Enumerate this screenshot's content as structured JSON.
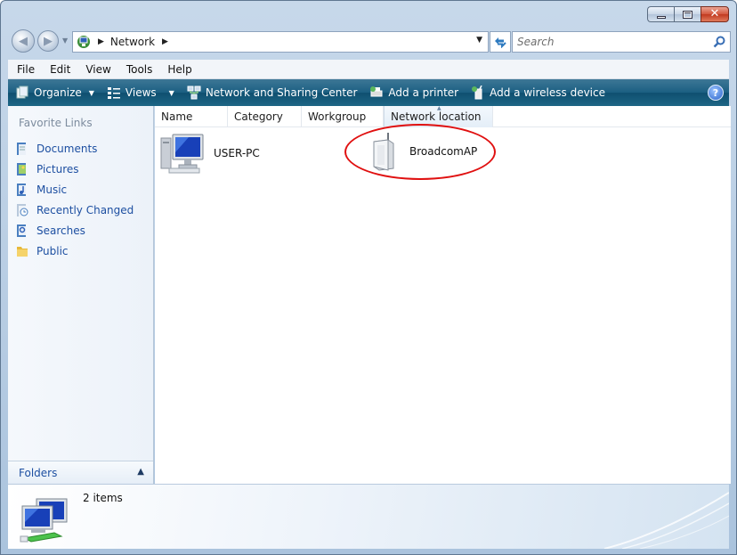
{
  "address": {
    "crumbs": [
      "Network"
    ]
  },
  "search": {
    "placeholder": "Search"
  },
  "menu": [
    "File",
    "Edit",
    "View",
    "Tools",
    "Help"
  ],
  "toolbar": {
    "organize": "Organize",
    "views": "Views",
    "network_sharing": "Network and Sharing Center",
    "add_printer": "Add a printer",
    "add_wireless": "Add a wireless device"
  },
  "left_pane": {
    "header": "Favorite Links",
    "items": [
      "Documents",
      "Pictures",
      "Music",
      "Recently Changed",
      "Searches",
      "Public"
    ],
    "folders_label": "Folders"
  },
  "columns": [
    "Name",
    "Category",
    "Workgroup",
    "Network location"
  ],
  "items": [
    {
      "name": "USER-PC",
      "icon": "computer-icon"
    },
    {
      "name": "BroadcomAP",
      "icon": "access-point-icon"
    }
  ],
  "status": {
    "count": "2 items"
  },
  "colors": {
    "command_bar": "#1b5f82",
    "link": "#1d4fa1",
    "highlight_ring": "#e01010"
  }
}
